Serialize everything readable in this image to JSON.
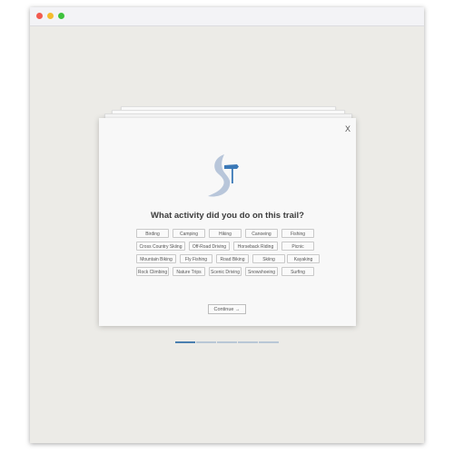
{
  "window": {
    "traffic_lights": [
      "close",
      "minimize",
      "zoom"
    ]
  },
  "modal": {
    "close_label": "X",
    "logo_icon": "trail-s-signpost-logo",
    "question": "What activity did you do on this trail?",
    "activities": [
      [
        "Birding",
        "Camping",
        "Hiking",
        "Canoeing",
        "Fishing"
      ],
      [
        "Cross Country Skiing",
        "Off-Road Driving",
        "Horseback Riding",
        "Picnic"
      ],
      [
        "Mountain Biking",
        "Fly Fishing",
        "Road Biking",
        "Skiing",
        "Kayaking"
      ],
      [
        "Rock Climbing",
        "Nature Trips",
        "Scenic Driving",
        "Snowshoeing",
        "Surfing"
      ]
    ],
    "continue_label": "Continue",
    "continue_icon": "arrow-right-icon"
  },
  "progress": {
    "total_steps": 5,
    "current_step": 1,
    "active_color": "#4a7fb0",
    "inactive_color": "#b9c7d6"
  }
}
